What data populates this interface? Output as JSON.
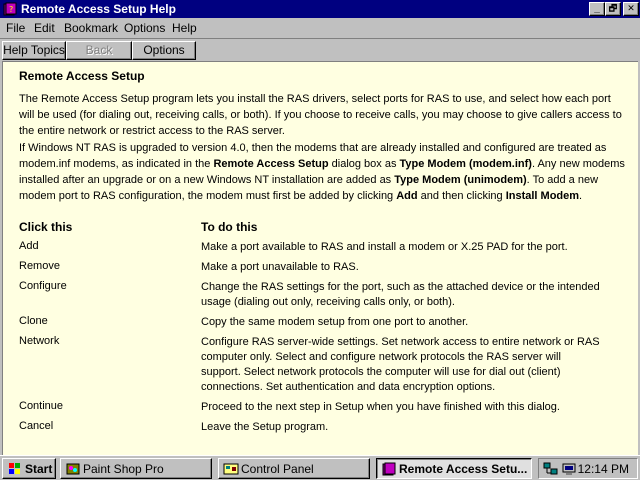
{
  "window": {
    "title": "Remote Access Setup Help",
    "controls": {
      "minimize": "_",
      "maximize": "🗗",
      "close": "✕"
    }
  },
  "menu": [
    "File",
    "Edit",
    "Bookmark",
    "Options",
    "Help"
  ],
  "toolbar": {
    "help_topics": "Help Topics",
    "back": "Back",
    "options": "Options"
  },
  "content": {
    "heading": "Remote Access Setup",
    "para1": "The Remote Access Setup program lets you install the RAS drivers, select ports for RAS to use, and select how each port will be used (for dialing out, receiving calls, or both). If you choose to receive calls, you may choose to give callers access to the entire network or restrict access to the RAS server.",
    "para2": {
      "t1": "If Windows NT RAS is upgraded to version 4.0, then the modems that are already installed and configured are treated as modem.inf modems, as indicated in the ",
      "b1": "Remote Access Setup",
      "t2": " dialog box as ",
      "b2": "Type Modem (modem.inf)",
      "t3": ". Any new modems installed after an upgrade or on a new Windows NT installation are added as ",
      "b3": "Type Modem (unimodem)",
      "t4": ". To add a new modem port to RAS configuration, the modem must first be added by clicking ",
      "b4": "Add",
      "t5": " and then clicking ",
      "b5": "Install Modem",
      "t6": "."
    },
    "col_click": "Click this",
    "col_do": "To do this",
    "rows": [
      {
        "label": "Add",
        "desc": "Make a port available to RAS and install a modem or X.25 PAD for the port."
      },
      {
        "label": "Remove",
        "desc": "Make a port unavailable to RAS."
      },
      {
        "label": "Configure",
        "desc": "Change the RAS settings for the port, such as the attached device or the intended usage (dialing out only, receiving calls only, or both)."
      },
      {
        "label": "Clone",
        "desc": "Copy the same modem setup from one port to another."
      },
      {
        "label": "Network",
        "desc": "Configure RAS server-wide settings. Set network access to entire network or RAS computer only. Select and configure network protocols the RAS server will support. Select network protocols the computer will use for dial out (client) connections. Set authentication and data encryption options."
      },
      {
        "label": "Continue",
        "desc": "Proceed to the next step in Setup when you have finished with this dialog."
      },
      {
        "label": "Cancel",
        "desc": "Leave the Setup program."
      }
    ]
  },
  "taskbar": {
    "start": "Start",
    "tasks": [
      {
        "label": "Paint Shop Pro",
        "icon": "paint-shop-pro-icon"
      },
      {
        "label": "Control Panel",
        "icon": "control-panel-icon"
      },
      {
        "label": "Remote Access Setu...",
        "icon": "help-book-icon"
      }
    ],
    "clock": "12:14 PM"
  },
  "colors": {
    "titlebar": "#000080",
    "content_bg": "#ffffe1",
    "chrome": "#c0c0c0"
  }
}
